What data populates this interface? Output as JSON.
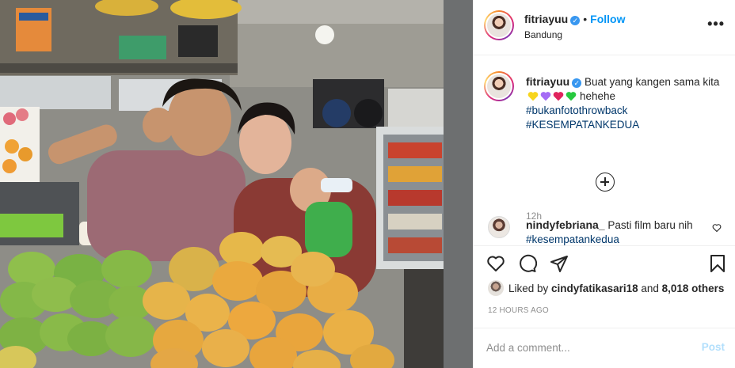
{
  "post": {
    "username": "fitriayuu",
    "follow_label": "Follow",
    "location": "Bandung",
    "caption_start": "Buat yang kangen sama kita",
    "caption_heart_colors": [
      "#f7d51d",
      "#a56cf5",
      "#e0245e",
      "#27c93f"
    ],
    "caption_end": "hehehe",
    "hashtags": [
      "#bukanfotothrowback",
      "#KESEMPATANKEDUA"
    ],
    "time_ago": "12h"
  },
  "comments": [
    {
      "username": "nindyfebriana_",
      "text": "Pasti film baru nih",
      "hashtag": "#kesempatankedua"
    }
  ],
  "likes": {
    "prefix": "Liked by ",
    "user": "cindyfatikasari18",
    "middle": " and ",
    "count": "8,018 others"
  },
  "timestamp": "12 HOURS AGO",
  "add_comment": {
    "placeholder": "Add a comment...",
    "post_label": "Post"
  },
  "icons": [
    "verified-badge-icon",
    "more-options-icon",
    "load-more-icon",
    "heart-icon",
    "comment-icon",
    "share-icon",
    "bookmark-icon"
  ],
  "colors": {
    "link": "#0095f6",
    "hashtag": "#00376b",
    "muted": "#8e8e8e",
    "post_disabled": "#b2dffc"
  }
}
